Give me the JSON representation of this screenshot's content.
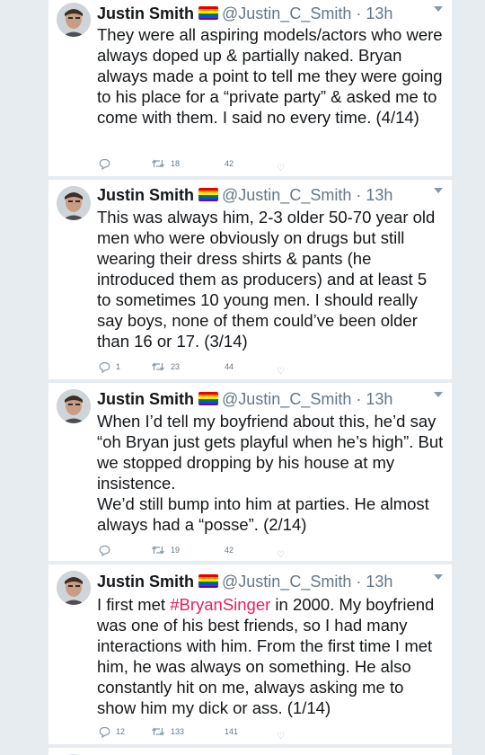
{
  "colors": {
    "background": "#e6ecf0",
    "card": "#ffffff",
    "text": "#14171a",
    "muted": "#657786",
    "hashtag": "#e0245e"
  },
  "icons": {
    "reply": "reply-icon",
    "retweet": "retweet-icon",
    "like": "heart-icon",
    "caret": "chevron-down-icon",
    "flag": "rainbow-flag-icon"
  },
  "tweets": [
    {
      "name": "Justin Smith",
      "handle": "@Justin_C_Smith",
      "time": "13h",
      "separator": "·",
      "paragraphs": [
        "They were all aspiring models/actors who were always doped up & partially naked. Bryan always made a point to tell me they were going to his place for a “private party” & asked me to come with them. I said no every time. (4/14)"
      ],
      "replies": "",
      "retweets": "18",
      "likes": "42"
    },
    {
      "name": "Justin Smith",
      "handle": "@Justin_C_Smith",
      "time": "13h",
      "separator": "·",
      "paragraphs": [
        "This was always him, 2-3 older 50-70 year old men who were obviously on drugs but still wearing their dress shirts & pants (he introduced them as producers) and at least 5 to sometimes 10 young men. I should really say boys, none of them could’ve been older than 16 or 17. (3/14)"
      ],
      "replies": "1",
      "retweets": "23",
      "likes": "44"
    },
    {
      "name": "Justin Smith",
      "handle": "@Justin_C_Smith",
      "time": "13h",
      "separator": "·",
      "paragraphs": [
        "When I’d tell my boyfriend about this, he’d say “oh Bryan just gets playful when he’s high”. But we stopped dropping by his house at my insistence.",
        "We’d still bump into him at parties. He almost always had a “posse”. (2/14)"
      ],
      "replies": "",
      "retweets": "19",
      "likes": "42"
    },
    {
      "name": "Justin Smith",
      "handle": "@Justin_C_Smith",
      "time": "13h",
      "separator": "·",
      "text_before": "I first met ",
      "hashtag": "#BryanSinger",
      "text_after": " in 2000. My boyfriend was one of his best friends, so I had many interactions with him. From the first time I met him, he was always on something. He also constantly hit on me, always asking me to show him my dick or ass. (1/14)",
      "replies": "12",
      "retweets": "133",
      "likes": "141"
    }
  ]
}
